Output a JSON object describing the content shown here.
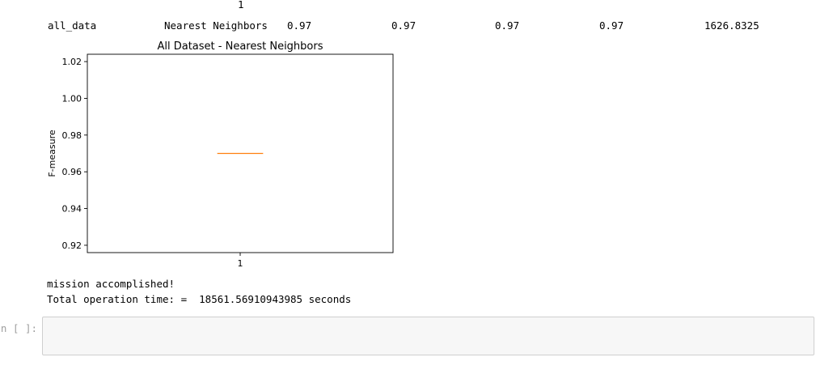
{
  "output": {
    "header_index": "1",
    "row": {
      "label": "all_data",
      "model": "Nearest Neighbors",
      "values": [
        "0.97",
        "0.97",
        "0.97",
        "0.97",
        "1626.8325"
      ]
    },
    "messages": {
      "line1": "mission accomplished!",
      "line2": "Total operation time: =  18561.56910943985 seconds"
    }
  },
  "input_cell": {
    "prompt": "n [ ]:",
    "value": ""
  },
  "chart_data": {
    "type": "box",
    "title": "All Dataset - Nearest Neighbors",
    "xlabel": "",
    "ylabel": "F-measure",
    "categories": [
      "1"
    ],
    "series": [
      {
        "median": 0.97,
        "q1": 0.97,
        "q3": 0.97,
        "whislo": 0.97,
        "whishi": 0.97
      }
    ],
    "ylim": [
      0.916,
      1.024
    ],
    "yticks": [
      "0.92",
      "0.94",
      "0.96",
      "0.98",
      "1.00",
      "1.02"
    ],
    "ytick_values": [
      0.92,
      0.94,
      0.96,
      0.98,
      1.0,
      1.02
    ],
    "median_color": "#ff7f0e",
    "grid": false
  }
}
